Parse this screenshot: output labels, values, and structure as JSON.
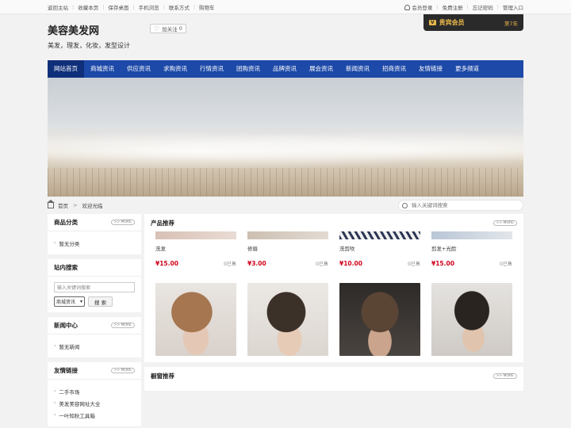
{
  "topbar": {
    "left_links": [
      "返回主站",
      "收藏本页",
      "保存桌面",
      "手机浏览",
      "联系方式",
      "购物车"
    ],
    "right_links": [
      "会员登录",
      "免费注册",
      "忘记密码",
      "管理入口"
    ]
  },
  "header": {
    "title": "美容美发网",
    "follow_label": "加关注",
    "follow_count": "0",
    "tagline": "美发，理发，化妆，发型设计",
    "vip_badge": "V",
    "vip_label": "贵宾会员",
    "vip_years": "第7年"
  },
  "nav": [
    "网站首页",
    "商城资讯",
    "供应资讯",
    "求购资讯",
    "行情资讯",
    "团购资讯",
    "品牌资讯",
    "展会资讯",
    "新闻资讯",
    "招商资讯",
    "友情链接",
    "更多频道"
  ],
  "breadcrumb": {
    "home": "首页",
    "sep": ">",
    "current": "欢迎光临"
  },
  "search": {
    "placeholder": "输入关键词搜索"
  },
  "more_label": ">> MORE",
  "sidebar": {
    "category": {
      "title": "商品分类",
      "items": [
        "暂无分类"
      ]
    },
    "site_search": {
      "title": "站内搜索",
      "placeholder": "输入关键词搜索",
      "select": "商城资讯",
      "button": "搜 索"
    },
    "news": {
      "title": "新闻中心",
      "items": [
        "暂无新闻"
      ]
    },
    "links": {
      "title": "友情链接",
      "items": [
        "二手市场",
        "美发美容网址大全",
        "一叶知秋工具箱"
      ]
    }
  },
  "products": {
    "title": "产品推荐",
    "items": [
      {
        "name": "洗发",
        "price": "¥15.00",
        "sold": "0已售"
      },
      {
        "name": "修眉",
        "price": "¥3.00",
        "sold": "0已售"
      },
      {
        "name": "洗剪吹",
        "price": "¥10.00",
        "sold": "0已售"
      },
      {
        "name": "剪发+光脸",
        "price": "¥15.00",
        "sold": "0已售"
      }
    ]
  },
  "shop_window": {
    "title": "橱窗推荐"
  },
  "colors": {
    "nav": "#1d49a8",
    "nav_active": "#0f2f7a",
    "price": "#d0021b",
    "vip_gold": "#e8b64a"
  }
}
